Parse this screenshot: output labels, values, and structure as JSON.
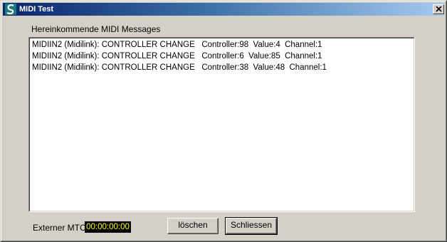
{
  "window": {
    "title": "MIDI Test"
  },
  "messages": {
    "label": "Hereinkommende MIDI Messages",
    "items": [
      "MIDIIN2 (Midilink): CONTROLLER CHANGE   Controller:98  Value:4  Channel:1",
      "MIDIIN2 (Midilink): CONTROLLER CHANGE   Controller:6  Value:85  Channel:1",
      "MIDIIN2 (Midilink): CONTROLLER CHANGE   Controller:38  Value:48  Channel:1"
    ]
  },
  "mtc": {
    "label": "Externer MTC",
    "value": "00:00:00:00"
  },
  "buttons": {
    "clear_label": "löschen",
    "close_label": "Schliessen"
  },
  "icons": {
    "app": "app-logo-icon",
    "close": "close-icon"
  },
  "colors": {
    "titlebar_start": "#0a246a",
    "titlebar_end": "#a6caf0",
    "mtc_background": "#000000",
    "mtc_text": "#ffff00"
  }
}
